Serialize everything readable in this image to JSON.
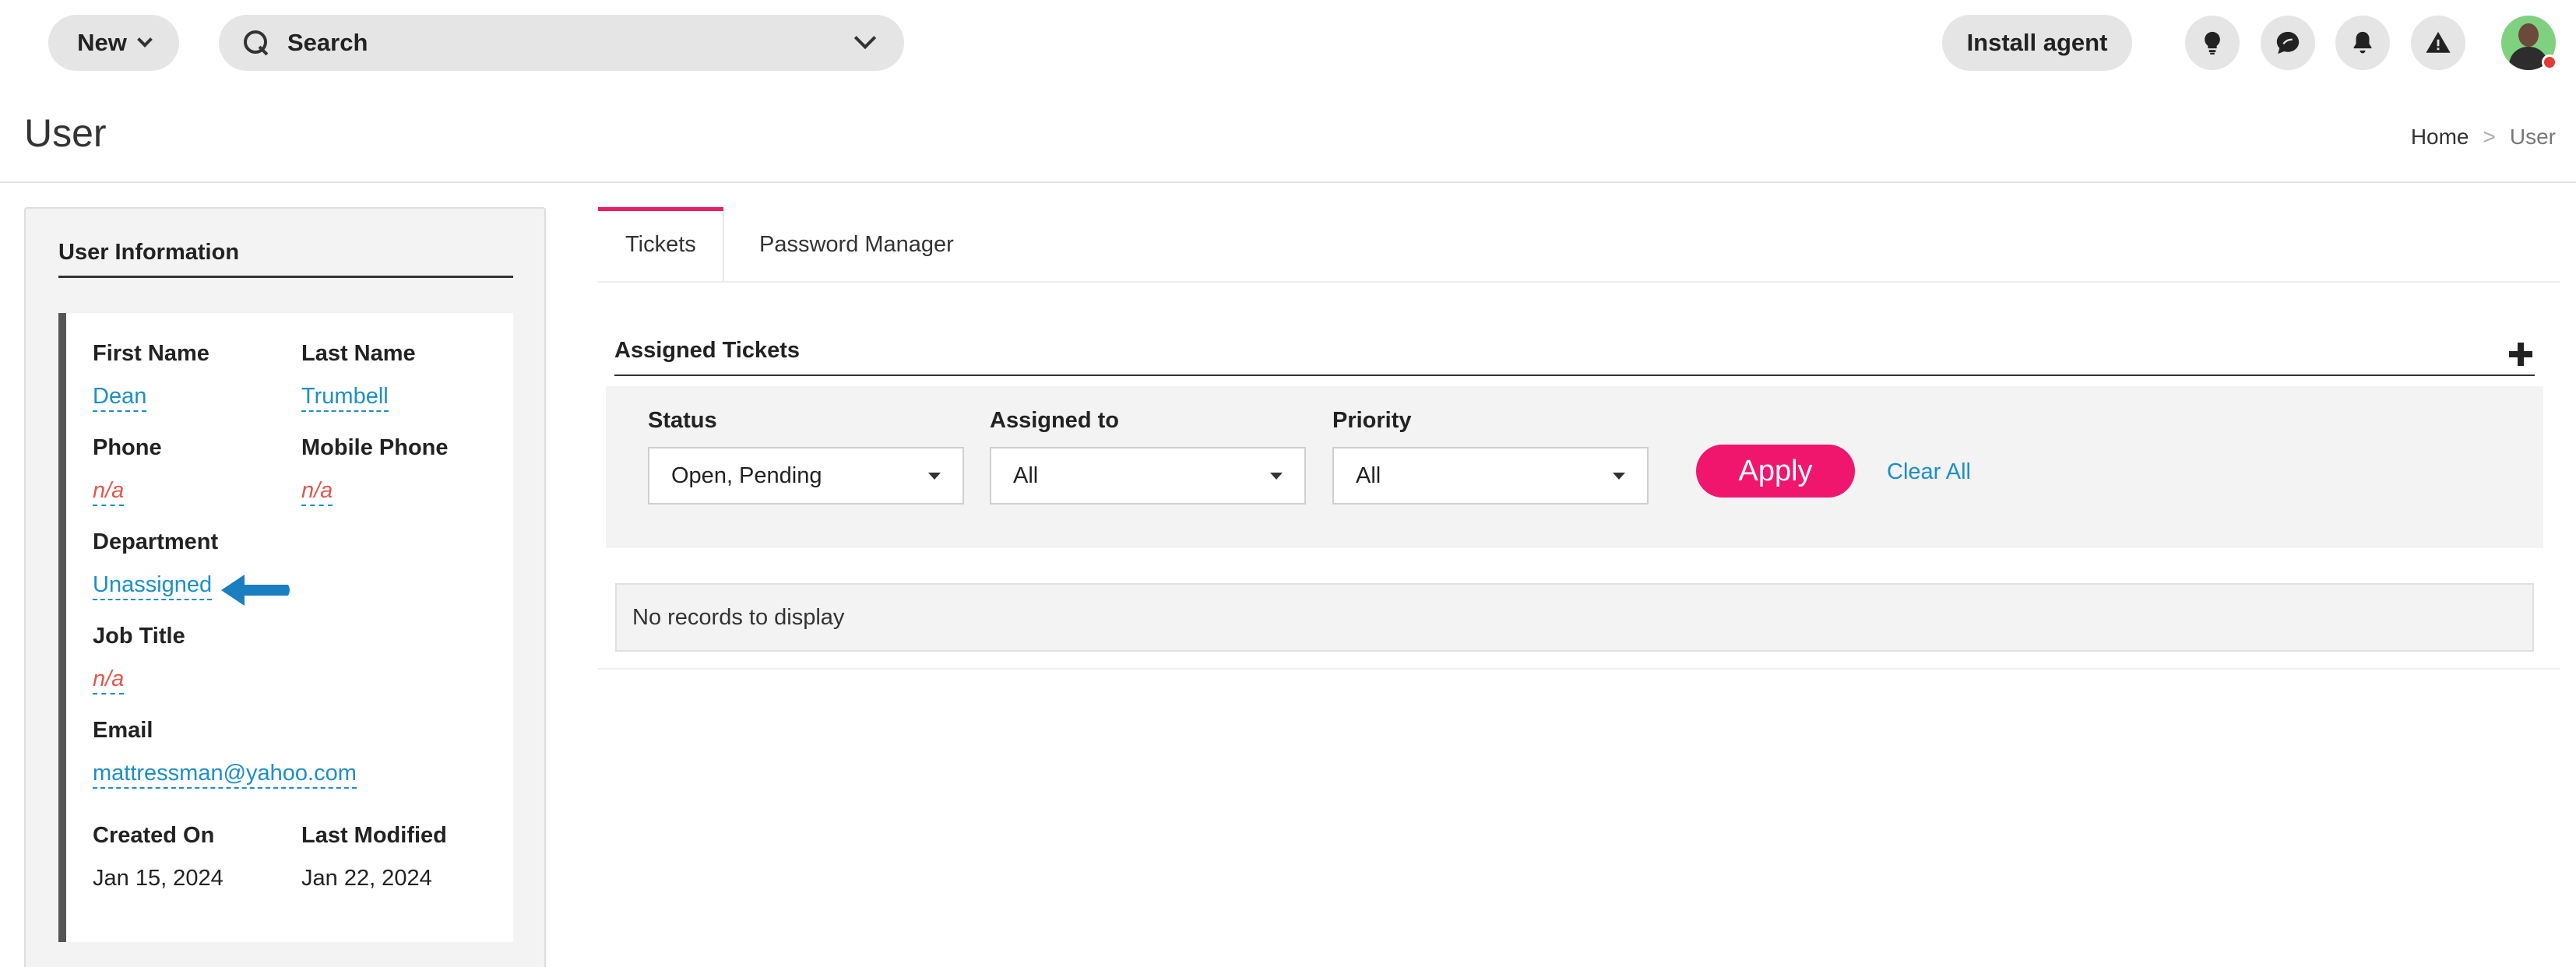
{
  "topbar": {
    "new_label": "New",
    "search_label": "Search",
    "install_label": "Install agent"
  },
  "page": {
    "title": "User",
    "breadcrumb": {
      "home": "Home",
      "separator": ">",
      "current": "User"
    }
  },
  "user_info": {
    "title": "User Information",
    "first_name_label": "First Name",
    "first_name": "Dean",
    "last_name_label": "Last Name",
    "last_name": "Trumbell",
    "phone_label": "Phone",
    "phone": "n/a",
    "mobile_label": "Mobile Phone",
    "mobile": "n/a",
    "department_label": "Department",
    "department": "Unassigned",
    "job_title_label": "Job Title",
    "job_title": "n/a",
    "email_label": "Email",
    "email": "mattressman@yahoo.com",
    "created_label": "Created On",
    "created": "Jan 15, 2024",
    "modified_label": "Last Modified",
    "modified": "Jan 22, 2024"
  },
  "tabs": [
    {
      "label": "Tickets",
      "active": true
    },
    {
      "label": "Password Manager",
      "active": false
    }
  ],
  "tickets": {
    "title": "Assigned Tickets",
    "filters": {
      "status_label": "Status",
      "status_value": "Open, Pending",
      "assigned_label": "Assigned to",
      "assigned_value": "All",
      "priority_label": "Priority",
      "priority_value": "All"
    },
    "apply_label": "Apply",
    "clear_label": "Clear All",
    "empty_text": "No records to display"
  },
  "colors": {
    "accent": "#f0166d",
    "link": "#1d8fc4",
    "na_text": "#e0584e",
    "annotation_arrow": "#1a7fc0"
  }
}
